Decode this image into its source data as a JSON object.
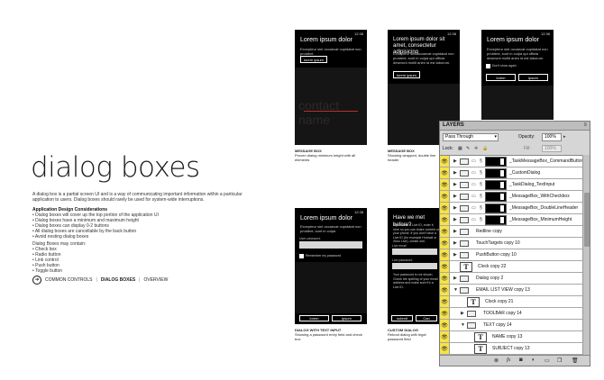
{
  "heading": "dialog boxes",
  "intro": "A dialog box is a partial screen UI and is a way of communicating important information within a particular application to users. Dialog boxes should rarely be used for system-wide interruptions.",
  "design": {
    "title": "Application Design Considerations",
    "items": [
      "• Dialog boxes will cover up the top portion of the application UI",
      "• Dialog boxes have a minimum and maximum height",
      "• Dialog boxes can display 0-2 buttons",
      "• All dialog boxes are cancellable by the back button",
      "• Avoid nesting dialog boxes"
    ]
  },
  "contains": {
    "title": "Dialog Boxes may contain:",
    "items": [
      "• Check box",
      "• Radio button",
      "• Link control",
      "• Push button",
      "• Toggle button"
    ]
  },
  "nav": {
    "common": "COMMON CONTROLS",
    "sep1": "|",
    "current": "DIALOG BOXES",
    "sep2": "|",
    "overview": "OVERVIEW"
  },
  "phones": {
    "p1": {
      "title": "Lorem ipsum dolor",
      "text": "Excepteur sint occaecat cupidatat non proident",
      "button": "lorem ipsum",
      "ghost": "contact name",
      "caption_title": "MESSAGE BOX",
      "caption": "Proven dialog minimum height with all elements"
    },
    "p2": {
      "title": "Lorem ipsum dolor sit amet, consectetur adipisicing",
      "text": "Excepteur sint occaecat cupidatat non proident, sunt in culpa qui officia deserunt mollit anim id est laborum.",
      "button": "lorem ipsum",
      "caption_title": "MESSAGE BOX",
      "caption": "Showing wrapped, double line header"
    },
    "p3": {
      "title": "Lorem ipsum dolor",
      "text": "Excepteur sint occaecat cupidatat non proident, sunt in culpa qui officia deserunt mollit anim id est laborum.",
      "check": "Don't show again",
      "btn1": "lorem",
      "btn2": "ipsum"
    },
    "p4": {
      "title": "Lorem ipsum dolor",
      "text": "Excepteur sint occaecat cupidatat non proident, sunt in culpa",
      "field_label": "User password",
      "check": "Remember my password",
      "btn1": "lorem",
      "btn2": "ipsum",
      "caption_title": "DIALOG WITH TEXT INPUT",
      "caption": "Showing a password entry field and check box"
    },
    "p5": {
      "title": "Have we met before?",
      "text": "If you have a Live ID, enter it here so you can share content on your phone. If you don't have a Live ID (for example Hotmail or Xbox Live), create one.",
      "field1": "Live email",
      "field2": "Live password",
      "note": "Your password is not shown. Check the spelling of your email address and make sure it's a Live ID.",
      "btn1": "submit",
      "btn2": "Can",
      "caption_title": "CUSTOM DIALOG",
      "caption": "Reboot dialog with legal password field"
    }
  },
  "layers": {
    "tab": "LAYERS",
    "blend": "Pass Through",
    "opacity_label": "Opacity:",
    "opacity": "100%",
    "lock_label": "Lock:",
    "fill_label": "Fill:",
    "fill": "100%",
    "rows": [
      {
        "name": "_TaskMessageBox_CommandButtons",
        "kind": "mask"
      },
      {
        "name": "_CustomDialog",
        "kind": "mask"
      },
      {
        "name": "_TaskDialog_TextInput",
        "kind": "mask"
      },
      {
        "name": "_MessageBox_WithCheckbox",
        "kind": "mask"
      },
      {
        "name": "_MessageBox_DoubleLineHeader",
        "kind": "mask"
      },
      {
        "name": "_MessageBox_MinimumHeight",
        "kind": "mask"
      },
      {
        "name": "Redline copy",
        "kind": "folder"
      },
      {
        "name": "TouchTargets copy 10",
        "kind": "folder"
      },
      {
        "name": "PushButton copy 10",
        "kind": "folder"
      },
      {
        "name": "Clock copy 22",
        "kind": "text"
      },
      {
        "name": "Dialog copy 2",
        "kind": "folder"
      },
      {
        "name": "EMAIL LIST VIEW copy 13",
        "kind": "folder"
      },
      {
        "name": "Clock copy 21",
        "kind": "text"
      },
      {
        "name": "TOOLBAR copy 14",
        "kind": "folder"
      },
      {
        "name": "TEXT copy 14",
        "kind": "folder"
      },
      {
        "name": "NAME copy 13",
        "kind": "text"
      },
      {
        "name": "SUBJECT copy 13",
        "kind": "text"
      }
    ]
  }
}
